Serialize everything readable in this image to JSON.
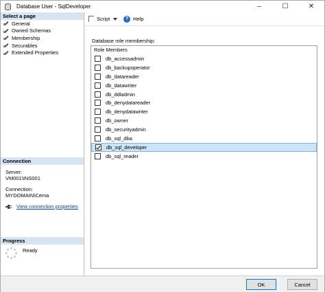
{
  "window": {
    "title": "Database User - SqlDeveloper",
    "minimize": "–",
    "maximize": "☐",
    "close": "✕"
  },
  "left": {
    "select_page_header": "Select a page",
    "pages": [
      {
        "label": "General"
      },
      {
        "label": "Owned Schemas"
      },
      {
        "label": "Membership"
      },
      {
        "label": "Securables"
      },
      {
        "label": "Extended Properties"
      }
    ],
    "connection_header": "Connection",
    "server_label": "Server:",
    "server_value": "VM001\\INS001",
    "connection_label": "Connection:",
    "connection_value": "MYDOMAIN\\Cema",
    "view_connection_link": "View connection properties",
    "progress_header": "Progress",
    "progress_status": "Ready"
  },
  "toolbar": {
    "script_label": "Script",
    "help_label": "Help"
  },
  "membership": {
    "group_label": "Database role membership:",
    "column_header": "Role Members",
    "roles": [
      {
        "name": "db_accessadmin",
        "checked": false
      },
      {
        "name": "db_backupoperator",
        "checked": false
      },
      {
        "name": "db_datareader",
        "checked": false
      },
      {
        "name": "db_datawriter",
        "checked": false
      },
      {
        "name": "db_ddladmin",
        "checked": false
      },
      {
        "name": "db_denydatareader",
        "checked": false
      },
      {
        "name": "db_denydatawriter",
        "checked": false
      },
      {
        "name": "db_owner",
        "checked": false
      },
      {
        "name": "db_securityadmin",
        "checked": false
      },
      {
        "name": "db_sql_dba",
        "checked": false
      },
      {
        "name": "db_sql_developer",
        "checked": true
      },
      {
        "name": "db_sql_reader",
        "checked": false
      }
    ]
  },
  "footer": {
    "ok_label": "OK",
    "cancel_label": "Cancel"
  }
}
